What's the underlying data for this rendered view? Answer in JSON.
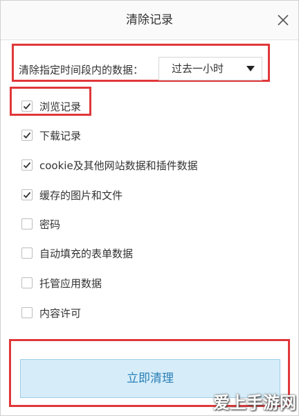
{
  "dialog": {
    "title": "清除记录",
    "close_icon": "close-icon"
  },
  "range": {
    "label": "清除指定时间段内的数据：",
    "selected": "过去一小时"
  },
  "items": [
    {
      "label": "浏览记录",
      "checked": true
    },
    {
      "label": "下载记录",
      "checked": true
    },
    {
      "label": "cookie及其他网站数据和插件数据",
      "checked": true
    },
    {
      "label": "缓存的图片和文件",
      "checked": true
    },
    {
      "label": "密码",
      "checked": false
    },
    {
      "label": "自动填充的表单数据",
      "checked": false
    },
    {
      "label": "托管应用数据",
      "checked": false
    },
    {
      "label": "内容许可",
      "checked": false
    }
  ],
  "action": {
    "button_label": "立即清理"
  },
  "watermark": "爱上手游网",
  "colors": {
    "highlight": "#e0373a",
    "button_bg": "#d6edf9",
    "button_text": "#2b7fb6"
  }
}
